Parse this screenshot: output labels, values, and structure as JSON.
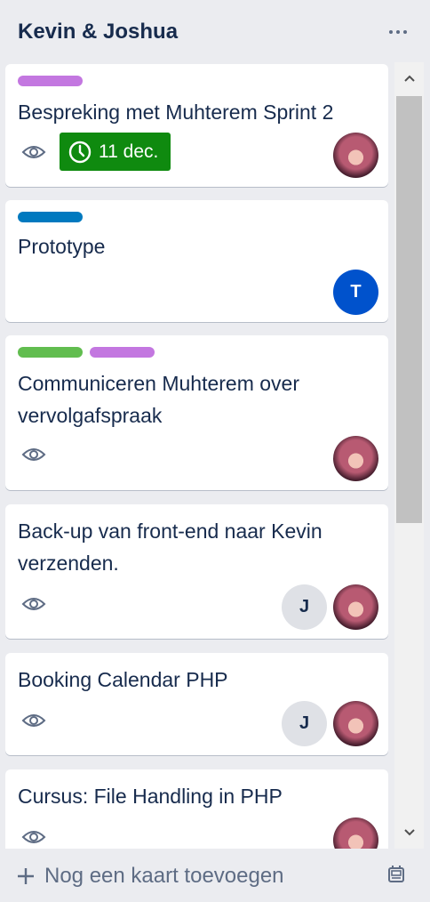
{
  "list": {
    "title": "Kevin & Joshua",
    "menu_icon": "more-horizontal-icon"
  },
  "colors": {
    "label_purple": "#c377e0",
    "label_blue": "#0079bf",
    "label_green": "#61bd4f",
    "due_complete_green": "#0f8a0f",
    "avatar_blue": "#0052cc"
  },
  "cards": [
    {
      "title": "Bespreking met Muhterem Sprint 2",
      "labels": [
        "purple"
      ],
      "watching": true,
      "due": "11 dec.",
      "members": [
        "avatar-photo"
      ]
    },
    {
      "title": "Prototype",
      "labels": [
        "blue"
      ],
      "watching": false,
      "members": [
        "T"
      ]
    },
    {
      "title_line1": "Communiceren Muhterem over",
      "title_line2": "vervolgafspraak",
      "labels": [
        "green",
        "purple"
      ],
      "watching": true,
      "members": [
        "avatar-photo"
      ]
    },
    {
      "title_line1": "Back-up van front-end naar Kevin",
      "title_line2": "verzenden.",
      "watching": true,
      "members": [
        "J",
        "avatar-photo"
      ]
    },
    {
      "title": "Booking Calendar PHP",
      "watching": true,
      "members": [
        "J",
        "avatar-photo"
      ]
    },
    {
      "title": "Cursus: File Handling in PHP",
      "watching": true,
      "members": [
        "avatar-photo"
      ]
    }
  ],
  "member_initials": {
    "t": "T",
    "j": "J"
  },
  "footer": {
    "add_card_label": "Nog een kaart toevoegen",
    "add_icon": "plus-icon",
    "template_icon": "card-template-icon"
  }
}
